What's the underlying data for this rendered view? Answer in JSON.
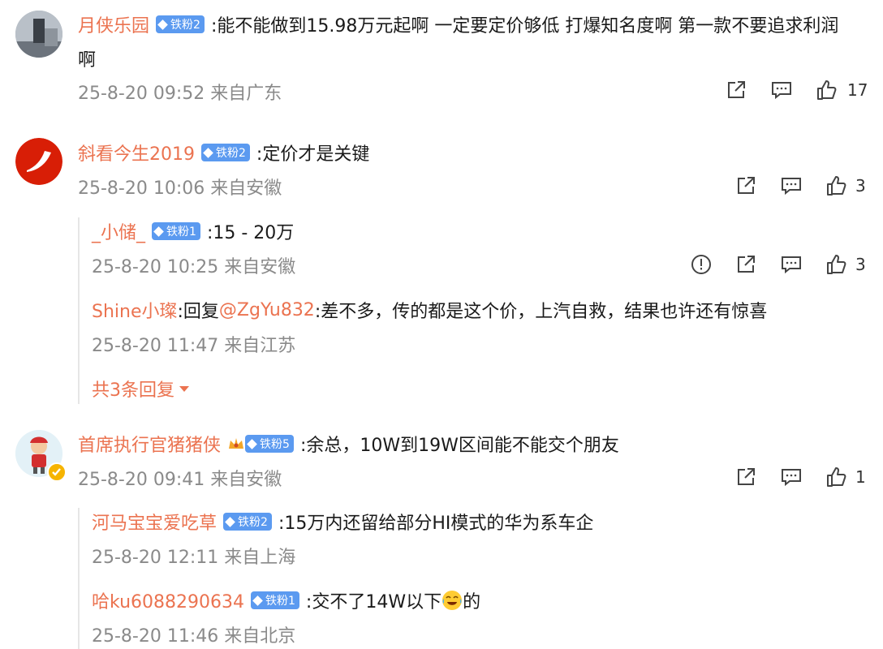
{
  "comments": [
    {
      "user": "月侠乐园",
      "badge": "铁粉2",
      "text_line1": ":能不能做到15.98万元起啊 一定要定价够低 打爆知名度啊 第一款不要追求利润",
      "text_line2": "啊",
      "meta": "25-8-20 09:52 来自广东",
      "likes": "17",
      "replies": []
    },
    {
      "user": "斜看今生2019",
      "badge": "铁粉2",
      "text": ":定价才是关键",
      "meta": "25-8-20 10:06 来自安徽",
      "likes": "3",
      "replies": [
        {
          "user": "_小储_",
          "badge": "铁粉1",
          "text": ":15 - 20万",
          "meta": "25-8-20 10:25 来自安徽",
          "likes": "3"
        },
        {
          "user": "Shine小璨",
          "text_prefix": ":回复",
          "mention": "@ZgYu832",
          "text": ":差不多，传的都是这个价，上汽自救，结果也许还有惊喜",
          "meta": "25-8-20 11:47 来自江苏"
        }
      ],
      "more_replies": "共3条回复"
    },
    {
      "user": "首席执行官猪猪侠",
      "badge": "铁粉5",
      "text": ":余总，10W到19W区间能不能交个朋友",
      "meta": "25-8-20 09:41 来自安徽",
      "likes": "1",
      "replies": [
        {
          "user": "河马宝宝爱吃草",
          "badge": "铁粉2",
          "text": ":15万内还留给部分HI模式的华为系车企",
          "meta": "25-8-20 12:11 来自上海"
        },
        {
          "user": "哈ku6088290634",
          "badge": "铁粉1",
          "text_before": ":交不了14W以下",
          "text_after": "的",
          "meta": "25-8-20 11:46 来自北京"
        }
      ]
    }
  ],
  "colors": {
    "username": "#eb7350",
    "badge": "#5b9af0",
    "meta": "#8a8a8a"
  }
}
